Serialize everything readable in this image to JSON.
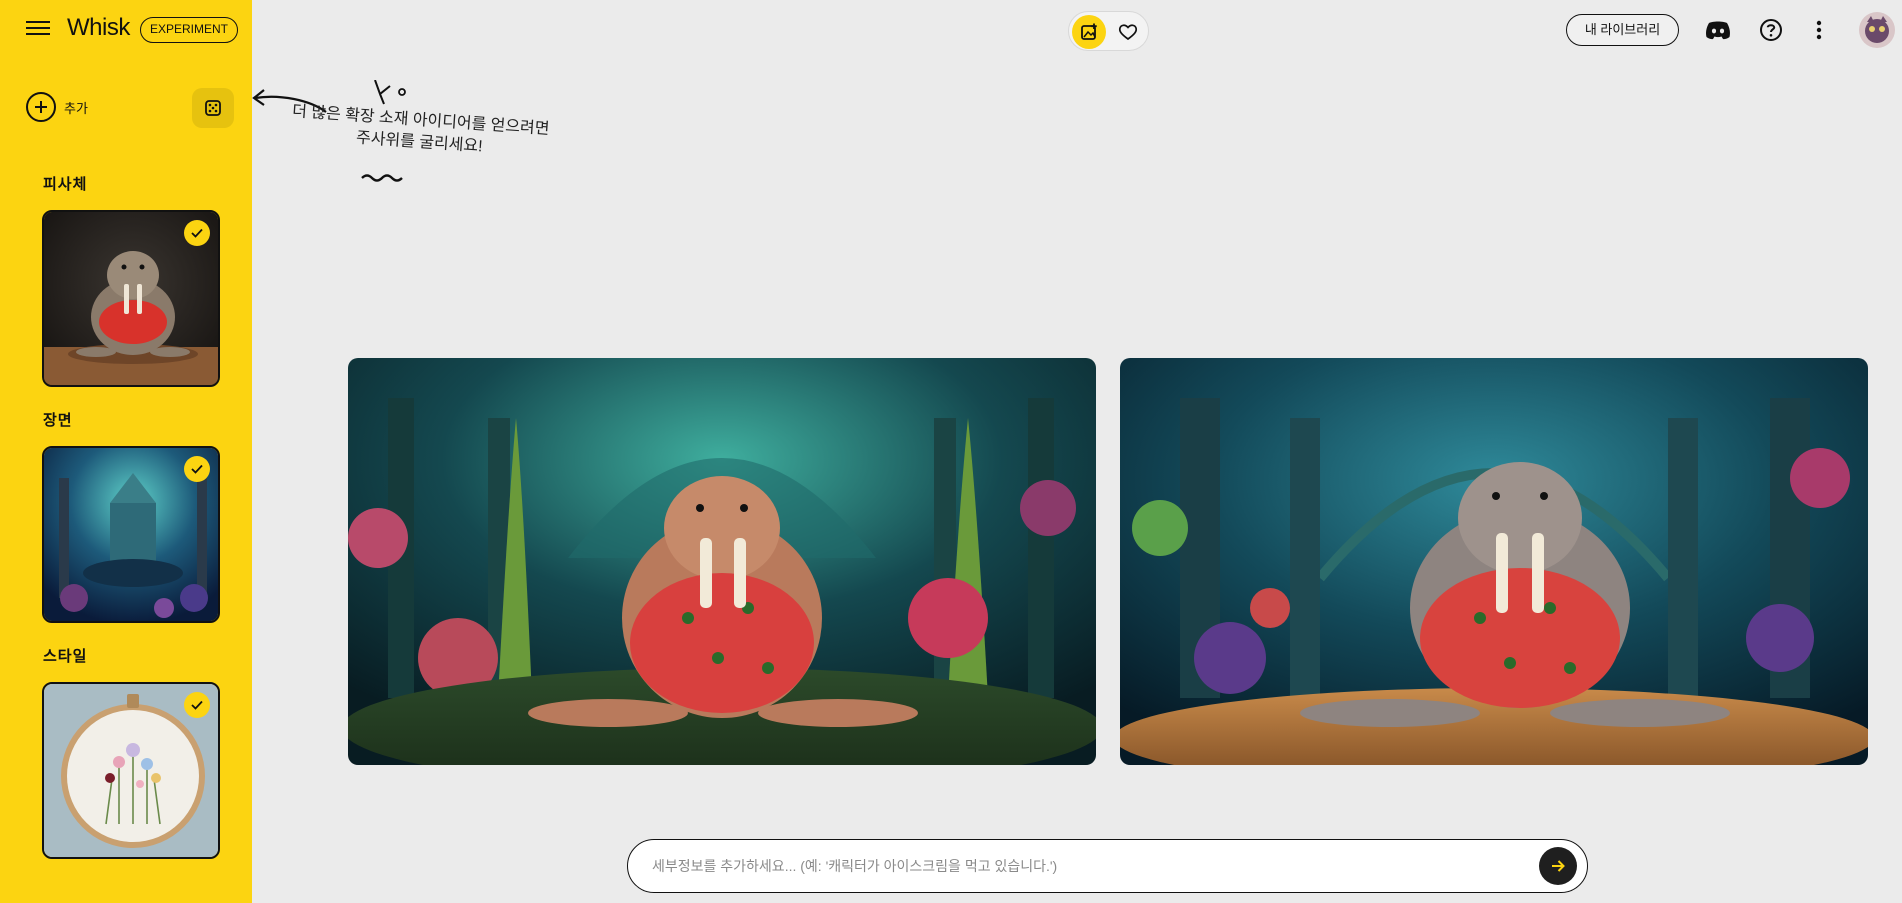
{
  "app": {
    "brand": "Whisk",
    "badge": "EXPERIMENT"
  },
  "sidebar": {
    "add_label": "추가",
    "sections": [
      {
        "label": "피사체",
        "selected": true
      },
      {
        "label": "장면",
        "selected": true
      },
      {
        "label": "스타일",
        "selected": true
      }
    ]
  },
  "annotation": {
    "line1": "더 많은 확장 소재 아이디어를 얻으려면",
    "line2": "주사위를 굴리세요!"
  },
  "header": {
    "library_label": "내 라이브러리",
    "icons": [
      "add-image-icon",
      "heart-icon",
      "discord-icon",
      "help-icon",
      "more-vert-icon",
      "avatar"
    ]
  },
  "prompt": {
    "placeholder": "세부정보를 추가하세요... (예: '캐릭터가 아이스크림을 먹고 있습니다.')"
  },
  "colors": {
    "accent": "#fcd411",
    "background": "#ebebeb",
    "dark": "#1f1f1f"
  }
}
